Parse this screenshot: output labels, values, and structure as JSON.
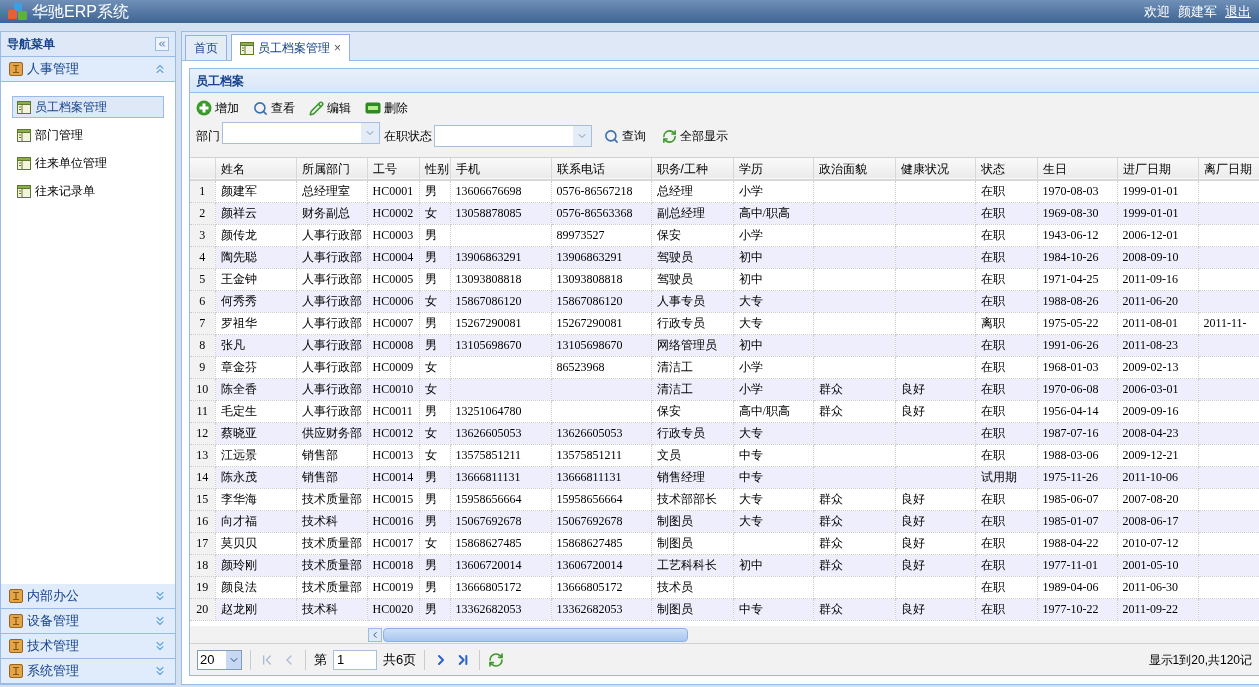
{
  "header": {
    "title": "华驰ERP系统",
    "welcome": "欢迎",
    "user": "颜建军",
    "logout": "退出"
  },
  "sidebar": {
    "title": "导航菜单",
    "sections": [
      {
        "label": "人事管理",
        "expanded": true,
        "items": [
          {
            "label": "员工档案管理",
            "selected": true
          },
          {
            "label": "部门管理",
            "selected": false
          },
          {
            "label": "往来单位管理",
            "selected": false
          },
          {
            "label": "往来记录单",
            "selected": false
          }
        ]
      },
      {
        "label": "内部办公",
        "expanded": false
      },
      {
        "label": "设备管理",
        "expanded": false
      },
      {
        "label": "技术管理",
        "expanded": false
      },
      {
        "label": "系统管理",
        "expanded": false
      }
    ]
  },
  "tabs": [
    {
      "label": "首页",
      "selected": false
    },
    {
      "label": "员工档案管理",
      "selected": true,
      "close": "×"
    }
  ],
  "panel": {
    "title": "员工档案",
    "toolbar": [
      {
        "kind": "add",
        "label": "增加"
      },
      {
        "kind": "view",
        "label": "查看"
      },
      {
        "kind": "edit",
        "label": "编辑"
      },
      {
        "kind": "delete",
        "label": "删除"
      }
    ],
    "filters": [
      {
        "label": "部门"
      },
      {
        "label": "在职状态"
      }
    ],
    "actions": [
      {
        "kind": "search",
        "label": "查询"
      },
      {
        "kind": "reload",
        "label": "全部显示"
      }
    ],
    "table": {
      "columns": [
        "姓名",
        "所属部门",
        "工号",
        "性别",
        "手机",
        "联系电话",
        "职务/工种",
        "学历",
        "政治面貌",
        "健康状况",
        "状态",
        "生日",
        "进厂日期",
        "离厂日期"
      ],
      "rows": [
        {
          "number": "1",
          "cells": [
            "颜建军",
            "总经理室",
            "HC0001",
            "男",
            "13606676698",
            "0576-86567218",
            "总经理",
            "小学",
            null,
            null,
            "在职",
            "1970-08-03",
            "1999-01-01",
            null
          ]
        },
        {
          "number": "2",
          "cells": [
            "颜祥云",
            "财务副总",
            "HC0002",
            "女",
            "13058878085",
            "0576-86563368",
            "副总经理",
            "高中/职高",
            null,
            null,
            "在职",
            "1969-08-30",
            "1999-01-01",
            null
          ]
        },
        {
          "number": "3",
          "cells": [
            "颜传龙",
            "人事行政部",
            "HC0003",
            "男",
            null,
            "89973527",
            "保安",
            "小学",
            null,
            null,
            "在职",
            "1943-06-12",
            "2006-12-01",
            null
          ]
        },
        {
          "number": "4",
          "cells": [
            "陶先聪",
            "人事行政部",
            "HC0004",
            "男",
            "13906863291",
            "13906863291",
            "驾驶员",
            "初中",
            null,
            null,
            "在职",
            "1984-10-26",
            "2008-09-10",
            null
          ]
        },
        {
          "number": "5",
          "cells": [
            "王金钟",
            "人事行政部",
            "HC0005",
            "男",
            "13093808818",
            "13093808818",
            "驾驶员",
            "初中",
            null,
            null,
            "在职",
            "1971-04-25",
            "2011-09-16",
            null
          ]
        },
        {
          "number": "6",
          "cells": [
            "何秀秀",
            "人事行政部",
            "HC0006",
            "女",
            "15867086120",
            "15867086120",
            "人事专员",
            "大专",
            null,
            null,
            "在职",
            "1988-08-26",
            "2011-06-20",
            null
          ]
        },
        {
          "number": "7",
          "cells": [
            "罗祖华",
            "人事行政部",
            "HC0007",
            "男",
            "15267290081",
            "15267290081",
            "行政专员",
            "大专",
            null,
            null,
            "离职",
            "1975-05-22",
            "2011-08-01",
            "2011-11-"
          ]
        },
        {
          "number": "8",
          "cells": [
            "张凡",
            "人事行政部",
            "HC0008",
            "男",
            "13105698670",
            "13105698670",
            "网络管理员",
            "初中",
            null,
            null,
            "在职",
            "1991-06-26",
            "2011-08-23",
            null
          ]
        },
        {
          "number": "9",
          "cells": [
            "章金芬",
            "人事行政部",
            "HC0009",
            "女",
            null,
            "86523968",
            "清洁工",
            "小学",
            null,
            null,
            "在职",
            "1968-01-03",
            "2009-02-13",
            null
          ]
        },
        {
          "number": "10",
          "cells": [
            "陈全香",
            "人事行政部",
            "HC0010",
            "女",
            null,
            null,
            "清洁工",
            "小学",
            "群众",
            "良好",
            "在职",
            "1970-06-08",
            "2006-03-01",
            null
          ]
        },
        {
          "number": "11",
          "cells": [
            "毛定生",
            "人事行政部",
            "HC0011",
            "男",
            "13251064780",
            null,
            "保安",
            "高中/职高",
            "群众",
            "良好",
            "在职",
            "1956-04-14",
            "2009-09-16",
            null
          ]
        },
        {
          "number": "12",
          "cells": [
            "蔡晓亚",
            "供应财务部",
            "HC0012",
            "女",
            "13626605053",
            "13626605053",
            "行政专员",
            "大专",
            null,
            null,
            "在职",
            "1987-07-16",
            "2008-04-23",
            null
          ]
        },
        {
          "number": "13",
          "cells": [
            "江远景",
            "销售部",
            "HC0013",
            "女",
            "13575851211",
            "13575851211",
            "文员",
            "中专",
            null,
            null,
            "在职",
            "1988-03-06",
            "2009-12-21",
            null
          ]
        },
        {
          "number": "14",
          "cells": [
            "陈永茂",
            "销售部",
            "HC0014",
            "男",
            "13666811131",
            "13666811131",
            "销售经理",
            "中专",
            null,
            null,
            "试用期",
            "1975-11-26",
            "2011-10-06",
            null
          ]
        },
        {
          "number": "15",
          "cells": [
            "李华海",
            "技术质量部",
            "HC0015",
            "男",
            "15958656664",
            "15958656664",
            "技术部部长",
            "大专",
            "群众",
            "良好",
            "在职",
            "1985-06-07",
            "2007-08-20",
            null
          ]
        },
        {
          "number": "16",
          "cells": [
            "向才福",
            "技术科",
            "HC0016",
            "男",
            "15067692678",
            "15067692678",
            "制图员",
            "大专",
            "群众",
            "良好",
            "在职",
            "1985-01-07",
            "2008-06-17",
            null
          ]
        },
        {
          "number": "17",
          "cells": [
            "莫贝贝",
            "技术质量部",
            "HC0017",
            "女",
            "15868627485",
            "15868627485",
            "制图员",
            null,
            "群众",
            "良好",
            "在职",
            "1988-04-22",
            "2010-07-12",
            null
          ]
        },
        {
          "number": "18",
          "cells": [
            "颜玲刚",
            "技术质量部",
            "HC0018",
            "男",
            "13606720014",
            "13606720014",
            "工艺科科长",
            "初中",
            "群众",
            "良好",
            "在职",
            "1977-11-01",
            "2001-05-10",
            null
          ]
        },
        {
          "number": "19",
          "cells": [
            "颜良法",
            "技术质量部",
            "HC0019",
            "男",
            "13666805172",
            "13666805172",
            "技术员",
            null,
            null,
            null,
            "在职",
            "1989-04-06",
            "2011-06-30",
            null
          ]
        },
        {
          "number": "20",
          "cells": [
            "赵龙刚",
            "技术科",
            "HC0020",
            "男",
            "13362682053",
            "13362682053",
            "制图员",
            "中专",
            "群众",
            "良好",
            "在职",
            "1977-10-22",
            "2011-09-22",
            null
          ]
        }
      ]
    },
    "pager": {
      "page_size": "20",
      "page_prefix": "第",
      "page": "1",
      "page_total": "共6页",
      "summary": "显示1到20,共120记"
    }
  }
}
